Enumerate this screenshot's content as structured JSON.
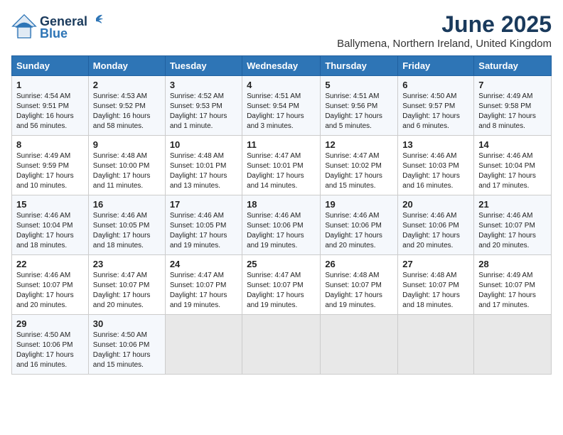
{
  "header": {
    "logo_line1": "General",
    "logo_line2": "Blue",
    "title": "June 2025",
    "subtitle": "Ballymena, Northern Ireland, United Kingdom"
  },
  "days_of_week": [
    "Sunday",
    "Monday",
    "Tuesday",
    "Wednesday",
    "Thursday",
    "Friday",
    "Saturday"
  ],
  "weeks": [
    [
      {
        "day": "1",
        "info": "Sunrise: 4:54 AM\nSunset: 9:51 PM\nDaylight: 16 hours and 56 minutes."
      },
      {
        "day": "2",
        "info": "Sunrise: 4:53 AM\nSunset: 9:52 PM\nDaylight: 16 hours and 58 minutes."
      },
      {
        "day": "3",
        "info": "Sunrise: 4:52 AM\nSunset: 9:53 PM\nDaylight: 17 hours and 1 minute."
      },
      {
        "day": "4",
        "info": "Sunrise: 4:51 AM\nSunset: 9:54 PM\nDaylight: 17 hours and 3 minutes."
      },
      {
        "day": "5",
        "info": "Sunrise: 4:51 AM\nSunset: 9:56 PM\nDaylight: 17 hours and 5 minutes."
      },
      {
        "day": "6",
        "info": "Sunrise: 4:50 AM\nSunset: 9:57 PM\nDaylight: 17 hours and 6 minutes."
      },
      {
        "day": "7",
        "info": "Sunrise: 4:49 AM\nSunset: 9:58 PM\nDaylight: 17 hours and 8 minutes."
      }
    ],
    [
      {
        "day": "8",
        "info": "Sunrise: 4:49 AM\nSunset: 9:59 PM\nDaylight: 17 hours and 10 minutes."
      },
      {
        "day": "9",
        "info": "Sunrise: 4:48 AM\nSunset: 10:00 PM\nDaylight: 17 hours and 11 minutes."
      },
      {
        "day": "10",
        "info": "Sunrise: 4:48 AM\nSunset: 10:01 PM\nDaylight: 17 hours and 13 minutes."
      },
      {
        "day": "11",
        "info": "Sunrise: 4:47 AM\nSunset: 10:01 PM\nDaylight: 17 hours and 14 minutes."
      },
      {
        "day": "12",
        "info": "Sunrise: 4:47 AM\nSunset: 10:02 PM\nDaylight: 17 hours and 15 minutes."
      },
      {
        "day": "13",
        "info": "Sunrise: 4:46 AM\nSunset: 10:03 PM\nDaylight: 17 hours and 16 minutes."
      },
      {
        "day": "14",
        "info": "Sunrise: 4:46 AM\nSunset: 10:04 PM\nDaylight: 17 hours and 17 minutes."
      }
    ],
    [
      {
        "day": "15",
        "info": "Sunrise: 4:46 AM\nSunset: 10:04 PM\nDaylight: 17 hours and 18 minutes."
      },
      {
        "day": "16",
        "info": "Sunrise: 4:46 AM\nSunset: 10:05 PM\nDaylight: 17 hours and 18 minutes."
      },
      {
        "day": "17",
        "info": "Sunrise: 4:46 AM\nSunset: 10:05 PM\nDaylight: 17 hours and 19 minutes."
      },
      {
        "day": "18",
        "info": "Sunrise: 4:46 AM\nSunset: 10:06 PM\nDaylight: 17 hours and 19 minutes."
      },
      {
        "day": "19",
        "info": "Sunrise: 4:46 AM\nSunset: 10:06 PM\nDaylight: 17 hours and 20 minutes."
      },
      {
        "day": "20",
        "info": "Sunrise: 4:46 AM\nSunset: 10:06 PM\nDaylight: 17 hours and 20 minutes."
      },
      {
        "day": "21",
        "info": "Sunrise: 4:46 AM\nSunset: 10:07 PM\nDaylight: 17 hours and 20 minutes."
      }
    ],
    [
      {
        "day": "22",
        "info": "Sunrise: 4:46 AM\nSunset: 10:07 PM\nDaylight: 17 hours and 20 minutes."
      },
      {
        "day": "23",
        "info": "Sunrise: 4:47 AM\nSunset: 10:07 PM\nDaylight: 17 hours and 20 minutes."
      },
      {
        "day": "24",
        "info": "Sunrise: 4:47 AM\nSunset: 10:07 PM\nDaylight: 17 hours and 19 minutes."
      },
      {
        "day": "25",
        "info": "Sunrise: 4:47 AM\nSunset: 10:07 PM\nDaylight: 17 hours and 19 minutes."
      },
      {
        "day": "26",
        "info": "Sunrise: 4:48 AM\nSunset: 10:07 PM\nDaylight: 17 hours and 19 minutes."
      },
      {
        "day": "27",
        "info": "Sunrise: 4:48 AM\nSunset: 10:07 PM\nDaylight: 17 hours and 18 minutes."
      },
      {
        "day": "28",
        "info": "Sunrise: 4:49 AM\nSunset: 10:07 PM\nDaylight: 17 hours and 17 minutes."
      }
    ],
    [
      {
        "day": "29",
        "info": "Sunrise: 4:50 AM\nSunset: 10:06 PM\nDaylight: 17 hours and 16 minutes."
      },
      {
        "day": "30",
        "info": "Sunrise: 4:50 AM\nSunset: 10:06 PM\nDaylight: 17 hours and 15 minutes."
      },
      {
        "day": "",
        "info": ""
      },
      {
        "day": "",
        "info": ""
      },
      {
        "day": "",
        "info": ""
      },
      {
        "day": "",
        "info": ""
      },
      {
        "day": "",
        "info": ""
      }
    ]
  ]
}
